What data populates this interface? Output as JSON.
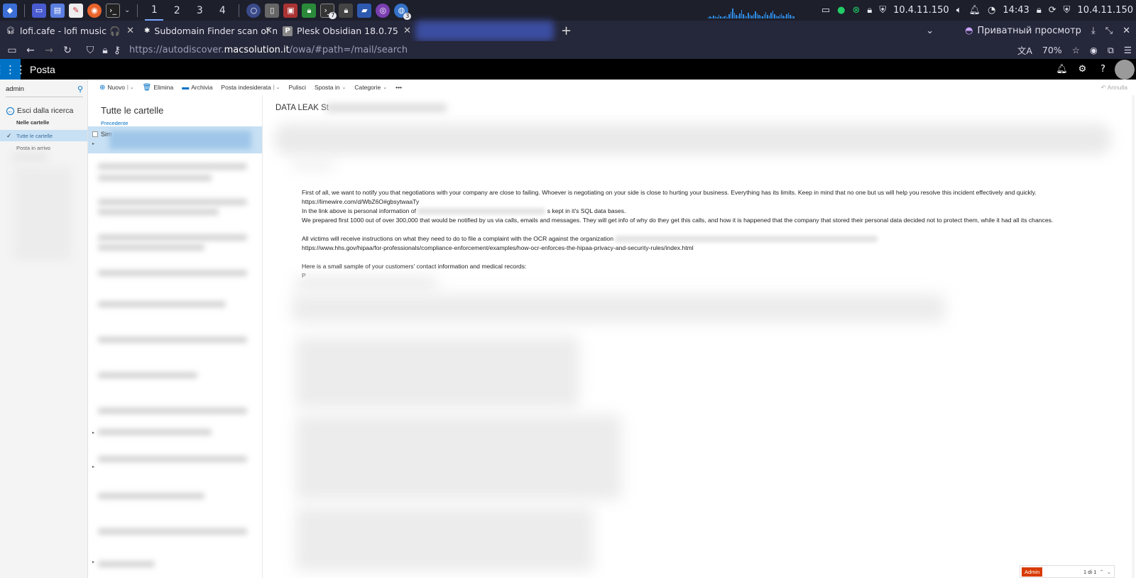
{
  "taskbar": {
    "workspaces": [
      "1",
      "2",
      "3",
      "4"
    ],
    "active_workspace": "1",
    "ip_left": "10.4.11.150",
    "time": "14:43",
    "ip_right": "10.4.11.150",
    "badge_terminal": "7",
    "badge_last": "3"
  },
  "tabs": [
    {
      "title": "lofi.cafe - lofi music 🎧",
      "icon": "headphones-icon"
    },
    {
      "title": "Subdomain Finder scan of m",
      "icon": "spider-icon"
    },
    {
      "title": "Plesk Obsidian 18.0.75",
      "icon": "plesk-icon"
    }
  ],
  "private_label": "Приватный просмотр",
  "url": {
    "prefix": "https://autodiscover.",
    "domain": "macsolution.it",
    "suffix": "/owa/#path=/mail/search"
  },
  "zoom": "70%",
  "owa": {
    "app_title": "Posta",
    "search_value": "admin",
    "exit_search": "Esci dalla ricerca",
    "folders_header": "Nelle cartelle",
    "folders": [
      "Tutte le cartelle",
      "Posta in arrivo"
    ],
    "toolbar": {
      "new": "Nuovo",
      "delete": "Elimina",
      "archive": "Archivia",
      "junk": "Posta indesiderata",
      "sweep": "Pulisci",
      "move": "Sposta in",
      "categories": "Categorie",
      "more": "•••",
      "undo": "Annulla"
    },
    "list": {
      "header": "Tutte le cartelle",
      "previous": "Precedente",
      "selected_sender": "Sim"
    },
    "message": {
      "subject": "DATA LEAK St",
      "body": {
        "p1": "First of all, we want to notify you that negotiations with your company are close to failing. Whoever is negotiating on your side is close to hurting your business. Everything has its limits. Keep in mind that no one but us will help you resolve this incident effectively and quickly.",
        "p2": "https://limewire.com/d/WbZ6O#gbsytwaaTy",
        "p3a": "In the link above is personal information of ",
        "p3b": "s kept in it's SQL data bases.",
        "p4": "We prepared first 1000 out of over 300,000 that would be notified by us via calls, emails and messages. They will get info of why do they get this calls, and how it is happened that the company that stored their personal data decided not to protect them, while it had all its chances.",
        "p5": "All victims will receive instructions on what they need to do to file a complaint with the OCR against the organization",
        "p6": "https://www.hhs.gov/hipaa/for-professionals/compliance-enforcement/examples/how-ocr-enforces-the-hipaa-privacy-and-security-rules/index.html",
        "p7": "Here is a small sample of your customers' contact information and medical records:",
        "p8": "P"
      }
    },
    "pager": {
      "tag": "Admin",
      "page": "1 di 1"
    }
  },
  "colors": {
    "taskbar_bg": "#1d1f2b",
    "owa_blue": "#0072c6",
    "selection": "#c7e0f4"
  }
}
